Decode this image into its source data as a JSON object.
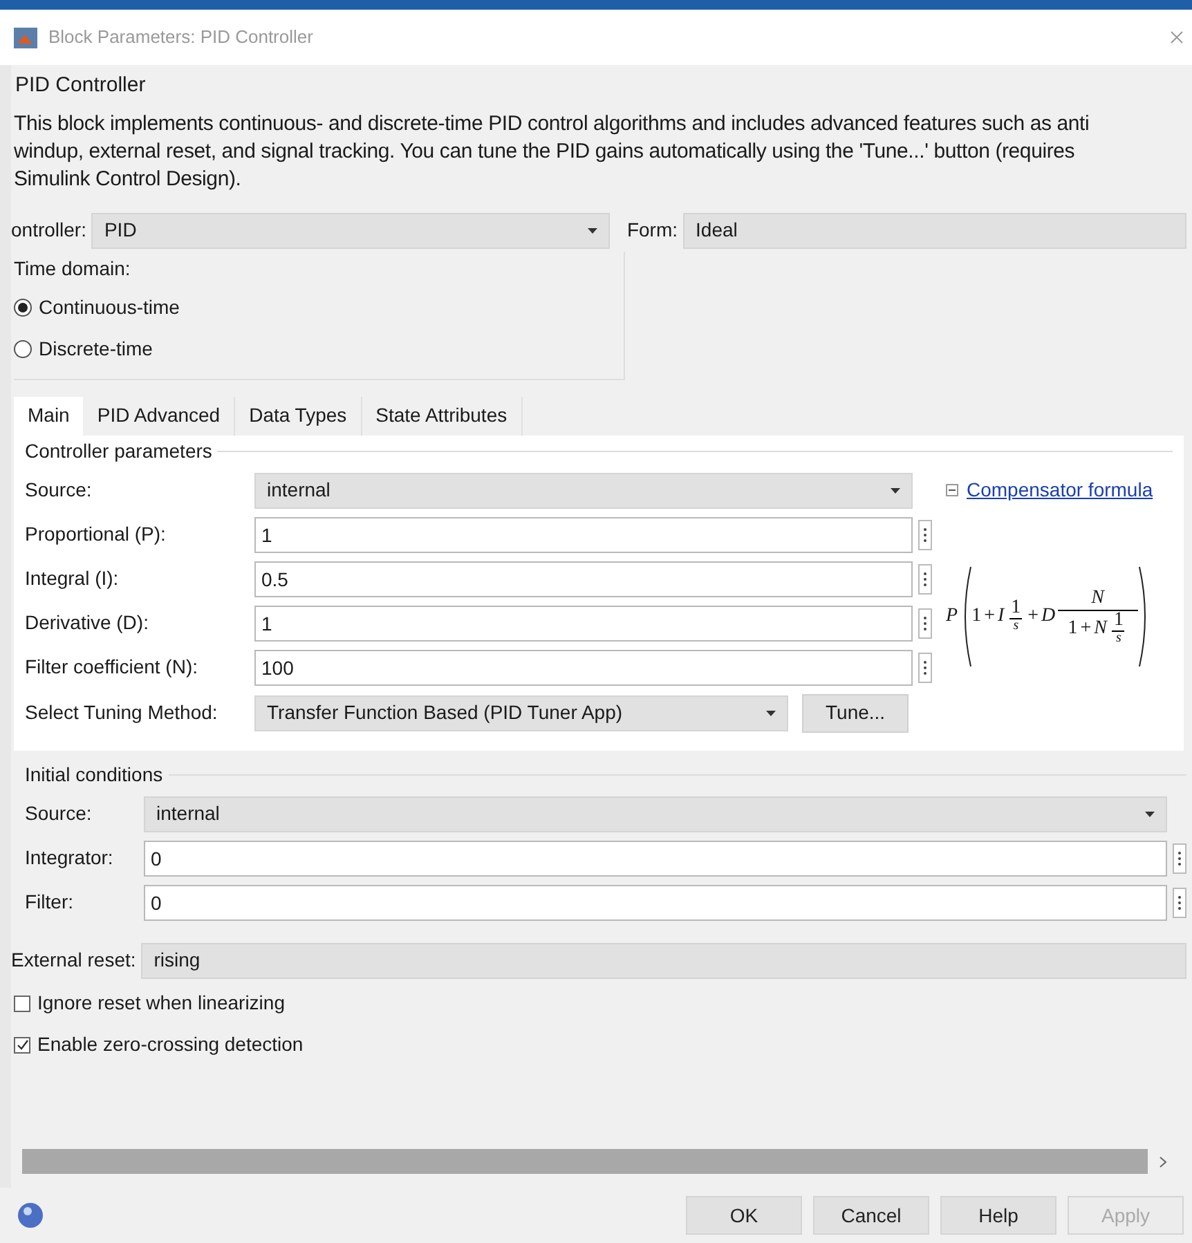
{
  "window": {
    "title": "Block Parameters: PID Controller"
  },
  "block_name": "PID Controller",
  "description": [
    "This block implements continuous- and discrete-time PID control algorithms and includes advanced features such as anti",
    "windup, external reset, and signal tracking. You can tune the PID gains automatically using the 'Tune...' button (requires",
    "Simulink Control Design)."
  ],
  "controller": {
    "label": "ontroller:",
    "value": "PID",
    "form_label": "Form:",
    "form_value": "Ideal"
  },
  "time_domain": {
    "title": "Time domain:",
    "options": [
      {
        "label": "Continuous-time",
        "selected": true
      },
      {
        "label": "Discrete-time",
        "selected": false
      }
    ]
  },
  "tabs": [
    {
      "label": "Main",
      "selected": true
    },
    {
      "label": "PID Advanced",
      "selected": false
    },
    {
      "label": "Data Types",
      "selected": false
    },
    {
      "label": "State Attributes",
      "selected": false
    }
  ],
  "controller_parameters": {
    "title": "Controller parameters",
    "rows": [
      {
        "kind": "dropdown",
        "label": "Source:",
        "value": "internal"
      },
      {
        "kind": "input",
        "label": "Proportional (P):",
        "value": "1"
      },
      {
        "kind": "input",
        "label": "Integral (I):",
        "value": "0.5"
      },
      {
        "kind": "input",
        "label": "Derivative (D):",
        "value": "1"
      },
      {
        "kind": "input",
        "label": "Filter coefficient (N):",
        "value": "100"
      }
    ],
    "tuning": {
      "label": "Select Tuning Method:",
      "value": "Transfer Function Based (PID Tuner App)",
      "button": "Tune..."
    },
    "compensator": {
      "link": "Compensator formula",
      "expanded": true,
      "formula": {
        "gain": "P",
        "one": "1",
        "plus": "+",
        "i": "I",
        "i_num": "1",
        "i_den": "s",
        "d": "D",
        "d_num": "N",
        "d_den_one": "1",
        "d_den_n": "N",
        "d_den_num": "1",
        "d_den_den": "s"
      }
    }
  },
  "initial_conditions": {
    "title": "Initial conditions",
    "rows": [
      {
        "kind": "dropdown",
        "label": "Source:",
        "value": "internal"
      },
      {
        "kind": "input",
        "label": "Integrator:",
        "value": "0"
      },
      {
        "kind": "input",
        "label": "Filter:",
        "value": "0"
      }
    ]
  },
  "external_reset": {
    "label": "External reset:",
    "value": "rising"
  },
  "checkboxes": [
    {
      "label": "Ignore reset when linearizing",
      "checked": false
    },
    {
      "label": "Enable zero-crossing detection",
      "checked": true
    }
  ],
  "buttons": [
    {
      "label": "OK",
      "disabled": false
    },
    {
      "label": "Cancel",
      "disabled": false
    },
    {
      "label": "Help",
      "disabled": false
    },
    {
      "label": "Apply",
      "disabled": true
    }
  ]
}
